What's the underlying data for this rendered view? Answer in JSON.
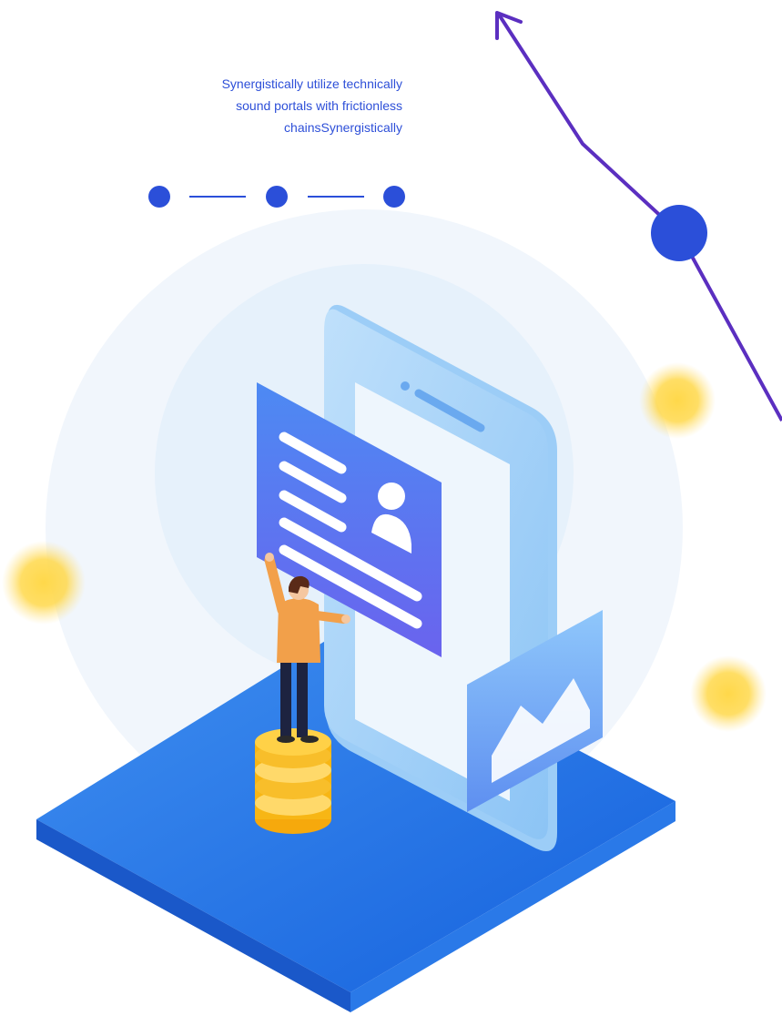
{
  "tagline": {
    "lines": [
      "Synergistically utilize technically",
      "sound portals with frictionless",
      "chainsSynergistically"
    ]
  },
  "colors": {
    "accent": "#2b4fd9",
    "arrow": "#5b2fc0",
    "platform": "#1f74e6",
    "coin": "#f6b514",
    "halo": "#eef5fc"
  },
  "icons": {
    "step_dots": [
      "dot-icon",
      "dot-icon",
      "dot-icon"
    ],
    "arrow": "arrow-up-left-icon",
    "profile_card": "id-card-icon",
    "chart_card": "mountain-chart-icon"
  }
}
